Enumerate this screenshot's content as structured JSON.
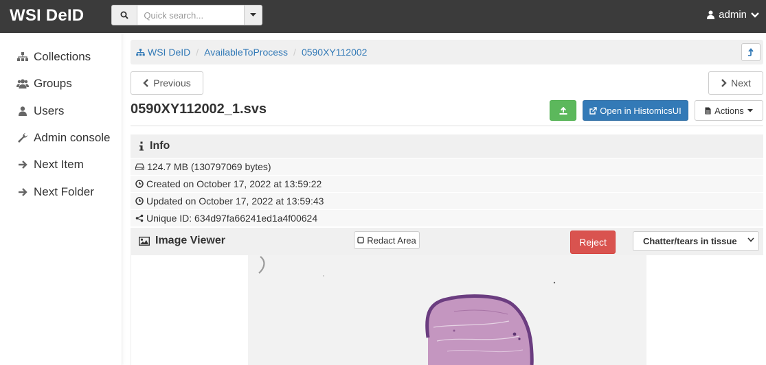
{
  "app": {
    "brand": "WSI DeID"
  },
  "search": {
    "placeholder": "Quick search...",
    "value": ""
  },
  "user": {
    "name": "admin"
  },
  "sidebar": {
    "items": [
      {
        "label": "Collections",
        "icon": "sitemap-icon"
      },
      {
        "label": "Groups",
        "icon": "users-icon"
      },
      {
        "label": "Users",
        "icon": "user-icon"
      },
      {
        "label": "Admin console",
        "icon": "wrench-icon"
      },
      {
        "label": "Next Item",
        "icon": "arrow-right-icon"
      },
      {
        "label": "Next Folder",
        "icon": "arrow-right-icon"
      }
    ]
  },
  "breadcrumb": [
    "WSI DeID",
    "AvailableToProcess",
    "0590XY112002"
  ],
  "nav": {
    "previous": "Previous",
    "next": "Next"
  },
  "item": {
    "title": "0590XY112002_1.svs"
  },
  "toolbar": {
    "histomics_label": "Open in HistomicsUI",
    "actions_label": "Actions"
  },
  "info": {
    "heading": "Info",
    "size": "124.7 MB (130797069 bytes)",
    "created": "Created on October 17, 2022 at 13:59:22",
    "updated": "Updated on October 17, 2022 at 13:59:43",
    "unique_id": "Unique ID: 634d97fa66241ed1a4f00624"
  },
  "viewer": {
    "heading": "Image Viewer",
    "redact_label": "Redact Area",
    "reject_label": "Reject",
    "reason_selected": "Chatter/tears in tissue"
  },
  "colors": {
    "navbar": "#3b3b3b",
    "link": "#337ab7",
    "success": "#5cb85c",
    "primary": "#337ab7",
    "danger": "#d9534f",
    "tissue_purple": "#b77fb0"
  }
}
